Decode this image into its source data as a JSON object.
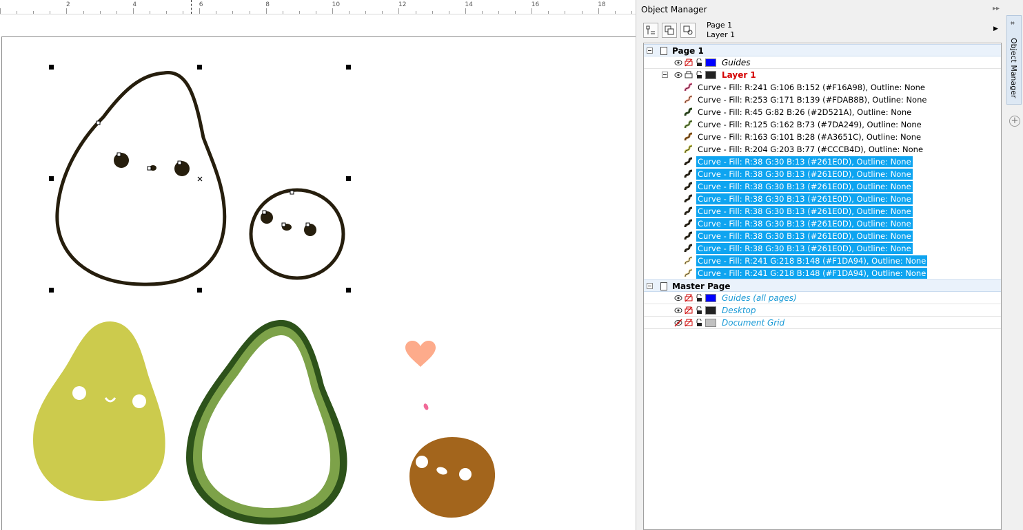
{
  "ruler": {
    "labels": [
      "2",
      "4",
      "6",
      "8",
      "10",
      "12",
      "14",
      "16",
      "18"
    ]
  },
  "panel": {
    "title": "Object Manager",
    "pin_icon": "double-arrow-icon",
    "crumb_page": "Page 1",
    "crumb_layer": "Layer 1",
    "docker_tab_label": "Object Manager",
    "docker_add_symbol": "+"
  },
  "tree": {
    "page1": {
      "label": "Page 1",
      "guides": {
        "label": "Guides",
        "color": "#0000ff"
      },
      "layer1": {
        "label": "Layer 1",
        "color": "#222222",
        "label_color": "#d40000"
      },
      "curves": [
        {
          "label": "Curve - Fill: R:241 G:106 B:152 (#F16A98), Outline: None",
          "icon_color": "#F16A98",
          "selected": false
        },
        {
          "label": "Curve - Fill: R:253 G:171 B:139 (#FDAB8B), Outline: None",
          "icon_color": "#FDAB8B",
          "selected": false
        },
        {
          "label": "Curve - Fill: R:45 G:82 B:26 (#2D521A), Outline: None",
          "icon_color": "#2D521A",
          "selected": false
        },
        {
          "label": "Curve - Fill: R:125 G:162 B:73 (#7DA249), Outline: None",
          "icon_color": "#7DA249",
          "selected": false
        },
        {
          "label": "Curve - Fill: R:163 G:101 B:28 (#A3651C), Outline: None",
          "icon_color": "#A3651C",
          "selected": false
        },
        {
          "label": "Curve - Fill: R:204 G:203 B:77 (#CCCB4D), Outline: None",
          "icon_color": "#CCCB4D",
          "selected": false
        },
        {
          "label": "Curve - Fill: R:38 G:30 B:13 (#261E0D), Outline: None",
          "icon_color": "#261E0D",
          "selected": true
        },
        {
          "label": "Curve - Fill: R:38 G:30 B:13 (#261E0D), Outline: None",
          "icon_color": "#261E0D",
          "selected": true
        },
        {
          "label": "Curve - Fill: R:38 G:30 B:13 (#261E0D), Outline: None",
          "icon_color": "#261E0D",
          "selected": true
        },
        {
          "label": "Curve - Fill: R:38 G:30 B:13 (#261E0D), Outline: None",
          "icon_color": "#261E0D",
          "selected": true
        },
        {
          "label": "Curve - Fill: R:38 G:30 B:13 (#261E0D), Outline: None",
          "icon_color": "#261E0D",
          "selected": true
        },
        {
          "label": "Curve - Fill: R:38 G:30 B:13 (#261E0D), Outline: None",
          "icon_color": "#261E0D",
          "selected": true
        },
        {
          "label": "Curve - Fill: R:38 G:30 B:13 (#261E0D), Outline: None",
          "icon_color": "#261E0D",
          "selected": true
        },
        {
          "label": "Curve - Fill: R:38 G:30 B:13 (#261E0D), Outline: None",
          "icon_color": "#261E0D",
          "selected": true
        },
        {
          "label": "Curve - Fill: R:241 G:218 B:148 (#F1DA94), Outline: None",
          "icon_color": "#F1DA94",
          "selected": true
        },
        {
          "label": "Curve - Fill: R:241 G:218 B:148 (#F1DA94), Outline: None",
          "icon_color": "#F1DA94",
          "selected": true
        }
      ]
    },
    "master": {
      "label": "Master Page",
      "layers": [
        {
          "label": "Guides (all pages)",
          "color": "#0000ff"
        },
        {
          "label": "Desktop",
          "color": "#222222"
        },
        {
          "label": "Document Grid",
          "color": "#c0c0c0"
        }
      ],
      "label_color": "#1a9ad6"
    }
  },
  "colors": {
    "outline_dark": "#261E0D",
    "pear_yellow": "#CCCB4D",
    "avocado_dark": "#2D521A",
    "avocado_light": "#7DA249",
    "pit_brown": "#A3651C",
    "heart_peach": "#FDAB8B",
    "blush_pink": "#F16A98",
    "selection_blue": "#0ea4f0"
  }
}
